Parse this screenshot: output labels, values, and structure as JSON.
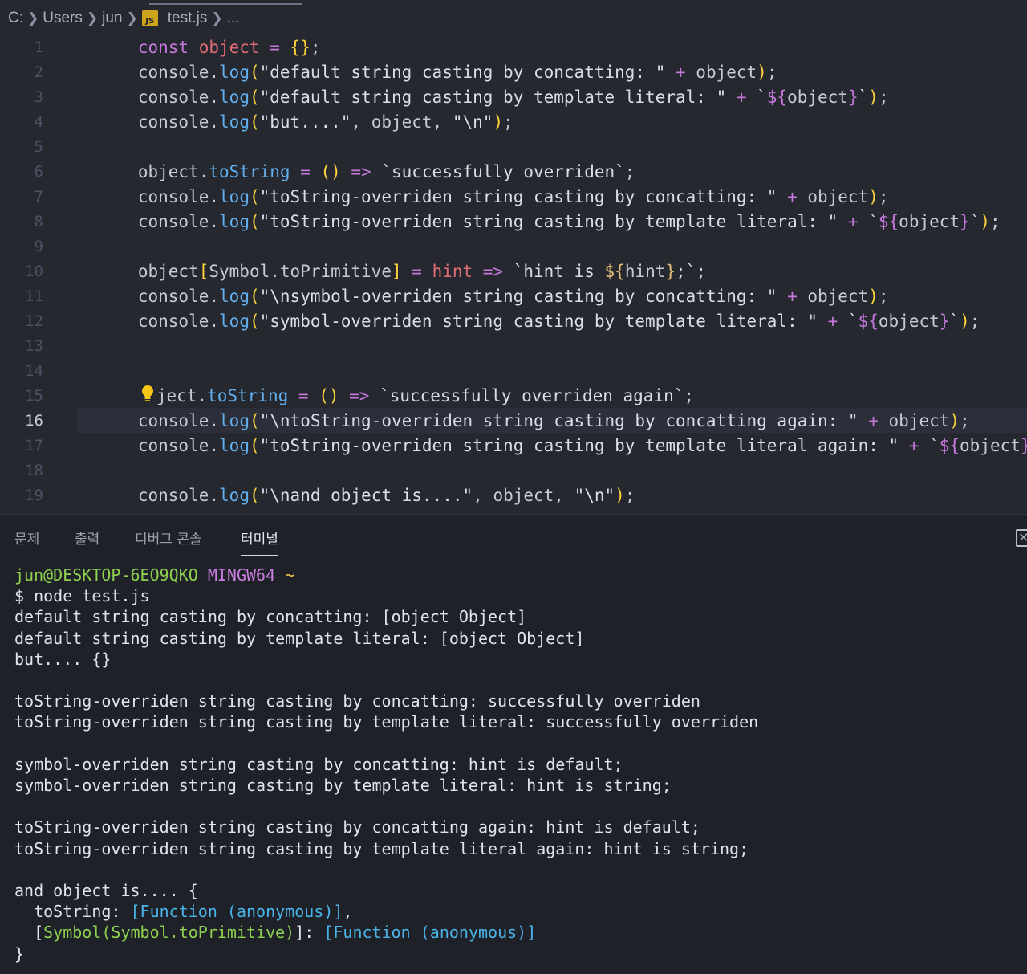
{
  "breadcrumb": {
    "drive": "C:",
    "folder1": "Users",
    "folder2": "jun",
    "file_icon": "JS",
    "file": "test.js",
    "more": "..."
  },
  "editor": {
    "active_line": 16,
    "lines": [
      {
        "n": "1"
      },
      {
        "n": "2"
      },
      {
        "n": "3"
      },
      {
        "n": "4"
      },
      {
        "n": "5"
      },
      {
        "n": "6"
      },
      {
        "n": "7"
      },
      {
        "n": "8"
      },
      {
        "n": "9"
      },
      {
        "n": "10"
      },
      {
        "n": "11"
      },
      {
        "n": "12"
      },
      {
        "n": "13"
      },
      {
        "n": "14"
      },
      {
        "n": "15"
      },
      {
        "n": "16"
      },
      {
        "n": "17"
      },
      {
        "n": "18"
      },
      {
        "n": "19"
      }
    ],
    "code": {
      "l1": [
        "const ",
        "object",
        " = ",
        "{}",
        ";"
      ],
      "l2": [
        "console",
        ".",
        "log",
        "(",
        "\"default string casting by concatting: \"",
        " + ",
        "object",
        ")",
        ";"
      ],
      "l3": [
        "console",
        ".",
        "log",
        "(",
        "\"default string casting by template literal: \"",
        " + ",
        "`",
        "${",
        "object",
        "}",
        "`",
        ")",
        ";"
      ],
      "l4": [
        "console",
        ".",
        "log",
        "(",
        "\"but....\"",
        ", ",
        "object",
        ", ",
        "\"\\n\"",
        ")",
        ";"
      ],
      "l6": [
        "object",
        ".",
        "toString",
        " = ",
        "()",
        " => ",
        "`successfully overriden`",
        ";"
      ],
      "l7": [
        "console",
        ".",
        "log",
        "(",
        "\"toString-overriden string casting by concatting: \"",
        " + ",
        "object",
        ")",
        ";"
      ],
      "l8": [
        "console",
        ".",
        "log",
        "(",
        "\"toString-overriden string casting by template literal: \"",
        " + ",
        "`",
        "${",
        "object",
        "}",
        "`",
        ")",
        ";"
      ],
      "l10": [
        "object",
        "[",
        "Symbol",
        ".",
        "toPrimitive",
        "]",
        " = ",
        "hint",
        " => ",
        "`hint is ",
        "${",
        "hint",
        "}",
        ";`",
        ";"
      ],
      "l11": [
        "console",
        ".",
        "log",
        "(",
        "\"\\nsymbol-overriden string casting by concatting: \"",
        " + ",
        "object",
        ")",
        ";"
      ],
      "l12": [
        "console",
        ".",
        "log",
        "(",
        "\"symbol-overriden string casting by template literal: \"",
        " + ",
        "`",
        "${",
        "object",
        "}",
        "`",
        ")",
        ";"
      ],
      "l15": [
        "ject",
        ".",
        "toString",
        " = ",
        "()",
        " => ",
        "`successfully overriden again`",
        ";"
      ],
      "l16": [
        "console",
        ".",
        "log",
        "(",
        "\"\\ntoString-overriden string casting by concatting again: \"",
        " + ",
        "object",
        ")",
        ";"
      ],
      "l17": [
        "console",
        ".",
        "log",
        "(",
        "\"toString-overriden string casting by template literal again: \"",
        " + ",
        "`",
        "${",
        "object",
        "}",
        "`",
        ")",
        ";"
      ],
      "l19": [
        "console",
        ".",
        "log",
        "(",
        "\"\\nand object is....\"",
        ", ",
        "object",
        ", ",
        "\"\\n\"",
        ")",
        ";"
      ]
    }
  },
  "panel": {
    "tabs": [
      "문제",
      "출력",
      "디버그 콘솔",
      "터미널"
    ],
    "active_tab": "터미널"
  },
  "terminal": {
    "prompt_user": "jun@DESKTOP-6EO9QKO",
    "prompt_env": "MINGW64",
    "prompt_path": "~",
    "command": "$ node test.js",
    "output": [
      "default string casting by concatting: [object Object]",
      "default string casting by template literal: [object Object]",
      "but.... {}",
      "",
      "toString-overriden string casting by concatting: successfully overriden",
      "toString-overriden string casting by template literal: successfully overriden",
      "",
      "symbol-overriden string casting by concatting: hint is default;",
      "symbol-overriden string casting by template literal: hint is string;",
      "",
      "toString-overriden string casting by concatting again: hint is default;",
      "toString-overriden string casting by template literal again: hint is string;",
      "",
      "and object is.... {"
    ],
    "obj_line1_key": "  toString: ",
    "obj_line1_val": "[Function (anonymous)]",
    "obj_line1_end": ",",
    "obj_line2_key_open": "  [",
    "obj_line2_key": "Symbol(Symbol.toPrimitive)",
    "obj_line2_key_close": "]: ",
    "obj_line2_val": "[Function (anonymous)]",
    "obj_close": "}"
  },
  "colors": {
    "editor_bg": "#262830",
    "panel_bg": "#1f2128",
    "keyword": "#c678dd",
    "variable": "#e06c75",
    "function": "#61afef",
    "bracket": "#ffd43b",
    "prompt_user": "#8fd14f",
    "prompt_env": "#c97ee0",
    "prompt_path": "#e8c547",
    "function_value": "#4ab3e8"
  },
  "icons": {
    "chevron": "chevron-right-icon",
    "lightbulb": "lightbulb-icon",
    "panel_close": "close-panel-icon"
  }
}
